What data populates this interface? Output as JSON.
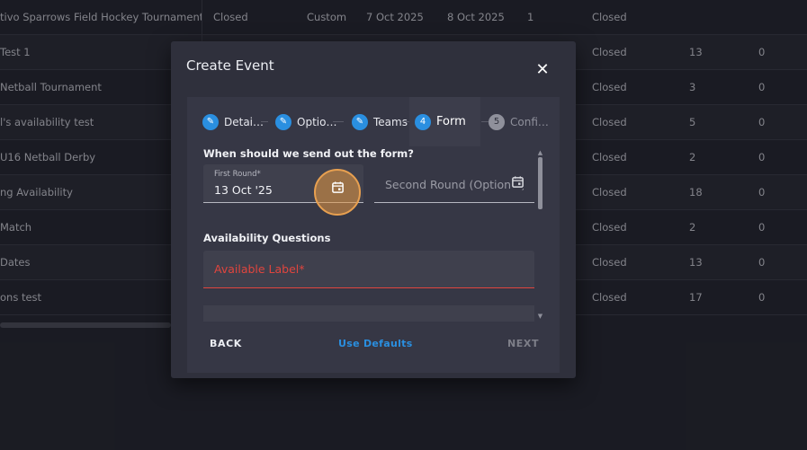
{
  "table": {
    "rows": [
      {
        "name": "tivo Sparrows Field Hockey Tournament",
        "status": "Closed",
        "type": "Custom",
        "start": "7 Oct 2025",
        "end": "8 Oct 2025",
        "n": "1",
        "status2": "Closed",
        "teams": "",
        "zero": ""
      },
      {
        "name": "Test 1",
        "status": "",
        "type": "",
        "start": "",
        "end": "",
        "n": "",
        "status2": "Closed",
        "teams": "13",
        "zero": "0"
      },
      {
        "name": "Netball Tournament",
        "status": "",
        "type": "",
        "start": "",
        "end": "",
        "n": "",
        "status2": "Closed",
        "teams": "3",
        "zero": "0"
      },
      {
        "name": "l's availability test",
        "status": "",
        "type": "",
        "start": "",
        "end": "",
        "n": "",
        "status2": "Closed",
        "teams": "5",
        "zero": "0"
      },
      {
        "name": "U16 Netball Derby",
        "status": "",
        "type": "",
        "start": "",
        "end": "",
        "n": "",
        "status2": "Closed",
        "teams": "2",
        "zero": "0"
      },
      {
        "name": "ng Availability",
        "status": "",
        "type": "",
        "start": "",
        "end": "",
        "n": "",
        "status2": "Closed",
        "teams": "18",
        "zero": "0"
      },
      {
        "name": "Match",
        "status": "",
        "type": "",
        "start": "",
        "end": "",
        "n": "",
        "status2": "Closed",
        "teams": "2",
        "zero": "0"
      },
      {
        "name": "Dates",
        "status": "",
        "type": "",
        "start": "",
        "end": "",
        "n": "",
        "status2": "Closed",
        "teams": "13",
        "zero": "0"
      },
      {
        "name": "ons test",
        "status": "",
        "type": "",
        "start": "",
        "end": "",
        "n": "",
        "status2": "Closed",
        "teams": "17",
        "zero": "0"
      }
    ]
  },
  "dialog": {
    "title": "Create Event",
    "close_icon": "close-icon",
    "steps": [
      {
        "index": "",
        "label": "Detai…",
        "state": "done",
        "icon": "pencil-icon"
      },
      {
        "index": "",
        "label": "Optio…",
        "state": "done",
        "icon": "pencil-icon"
      },
      {
        "index": "",
        "label": "Teams",
        "state": "done",
        "icon": "pencil-icon"
      },
      {
        "index": "4",
        "label": "Form",
        "state": "active"
      },
      {
        "index": "5",
        "label": "Confi…",
        "state": "pending"
      }
    ],
    "form": {
      "send_heading": "When should we send out the form?",
      "first_round_label": "First Round*",
      "first_round_value": "13 Oct '25",
      "second_round_placeholder": "Second Round (Optional)",
      "calendar_icon": "calendar-icon",
      "availability_title": "Availability Questions",
      "available_label_placeholder": "Available Label*"
    },
    "actions": {
      "back": "BACK",
      "defaults": "Use Defaults",
      "next": "NEXT"
    }
  },
  "colors": {
    "accent": "#2a8fe0",
    "error": "#e0453e",
    "highlight": "#e8a050"
  }
}
